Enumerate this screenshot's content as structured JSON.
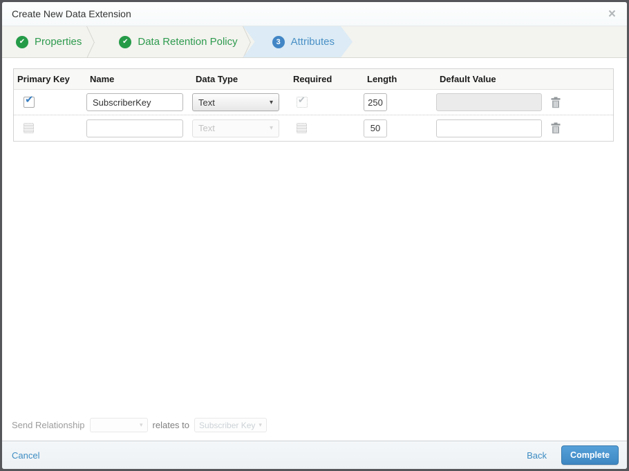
{
  "modal": {
    "title": "Create New Data Extension"
  },
  "icons": {
    "close": "×",
    "check": "✔",
    "caret": "▾"
  },
  "steps": [
    {
      "label": "Properties",
      "status": "complete"
    },
    {
      "label": "Data Retention Policy",
      "status": "complete"
    },
    {
      "label": "Attributes",
      "status": "active",
      "number": "3"
    }
  ],
  "table": {
    "headers": {
      "primary_key": "Primary Key",
      "name": "Name",
      "data_type": "Data Type",
      "required": "Required",
      "length": "Length",
      "default_value": "Default Value"
    },
    "rows": [
      {
        "primary_key_checked": true,
        "name": "SubscriberKey",
        "data_type": "Text",
        "required_checked": true,
        "required_disabled": true,
        "length": "250",
        "default_value": "",
        "default_disabled": true
      },
      {
        "primary_key_checked": false,
        "name": "",
        "data_type": "Text",
        "data_type_disabled": true,
        "required_checked": false,
        "length": "50",
        "default_value": "",
        "default_disabled": false
      }
    ]
  },
  "send_relationship": {
    "label": "Send Relationship",
    "relates_to": "relates to",
    "target": "Subscriber Key"
  },
  "footer": {
    "cancel": "Cancel",
    "back": "Back",
    "complete": "Complete"
  },
  "colors": {
    "success_green": "#259b48",
    "accent_blue": "#4a90c6",
    "button_blue": "#3d86c2",
    "active_step_bg": "#dcebf5"
  }
}
